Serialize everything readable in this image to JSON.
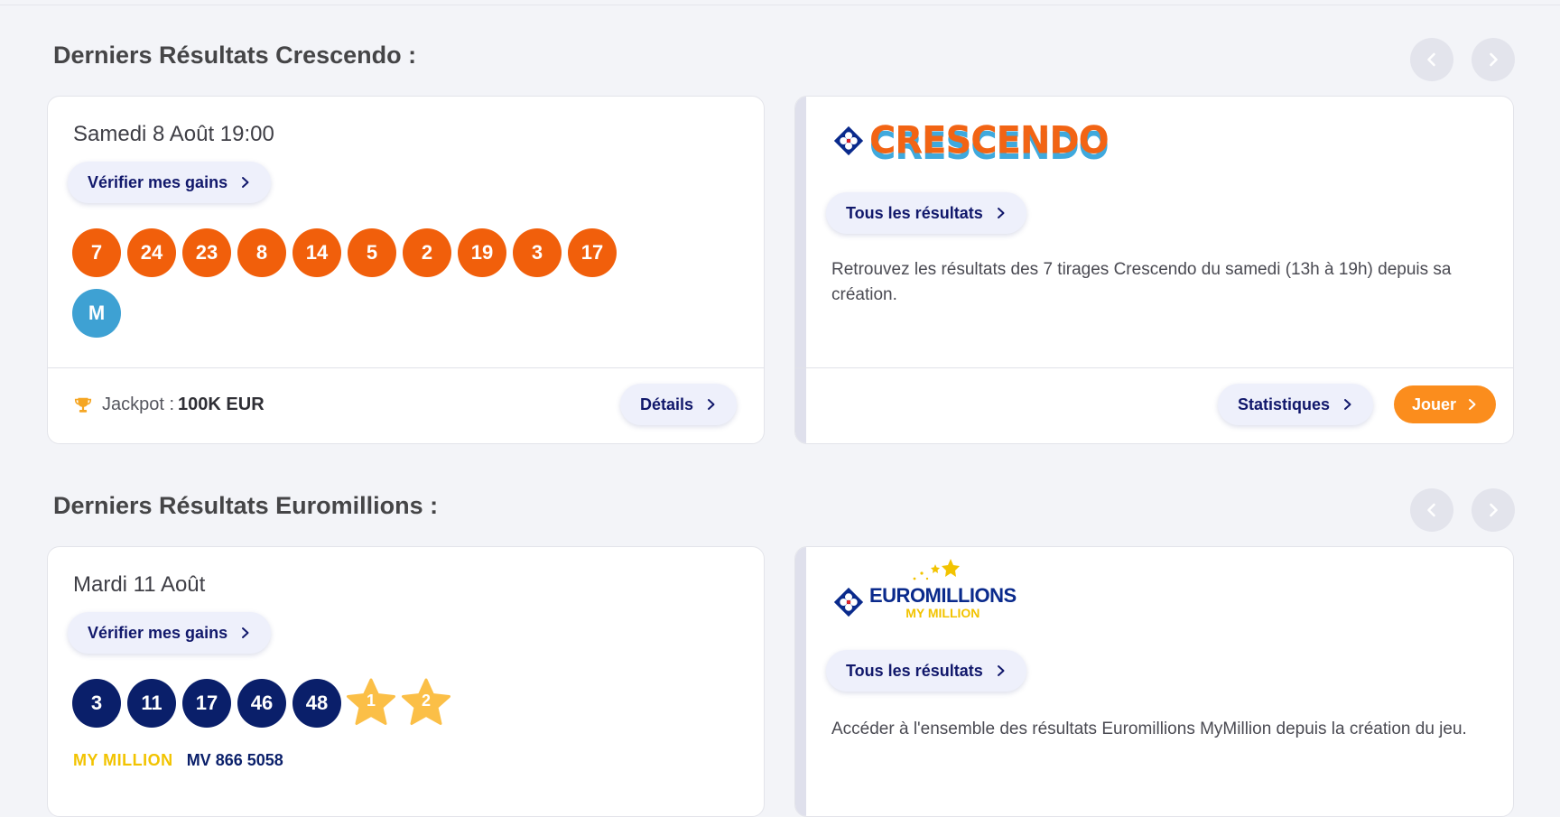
{
  "sections": [
    {
      "title": "Derniers Résultats Crescendo :",
      "draw": {
        "date": "Samedi 8 Août 19:00",
        "verify_label": "Vérifier mes gains",
        "numbers": [
          "7",
          "24",
          "23",
          "8",
          "14",
          "5",
          "2",
          "19",
          "3",
          "17"
        ],
        "special": "M",
        "jackpot_label": "Jackpot :",
        "jackpot_value": "100K EUR",
        "details_label": "Détails"
      },
      "game": {
        "logo_text": "CRESCENDO",
        "all_results_label": "Tous les résultats",
        "description": "Retrouvez les résultats des 7 tirages Crescendo du samedi (13h à 19h) depuis sa création.",
        "stats_label": "Statistiques",
        "play_label": "Jouer"
      }
    },
    {
      "title": "Derniers Résultats Euromillions :",
      "draw": {
        "date": "Mardi 11 Août",
        "verify_label": "Vérifier mes gains",
        "numbers": [
          "3",
          "11",
          "17",
          "46",
          "48"
        ],
        "stars": [
          "1",
          "2"
        ],
        "mymillion_logo": "MY MILLION",
        "mymillion_code": "MV 866 5058"
      },
      "game": {
        "logo_line1": "EUROMILLIONS",
        "logo_line2": "MY MILLION",
        "all_results_label": "Tous les résultats",
        "description": "Accéder à l'ensemble des résultats Euromillions MyMillion depuis la création du jeu."
      }
    }
  ],
  "icons": {
    "prev": "chevron-left-icon",
    "next": "chevron-right-icon",
    "trophy": "trophy-icon",
    "fdj": "fdj-clover-icon"
  },
  "colors": {
    "crescendo_ball": "#f15f0b",
    "special_ball": "#3ea1d3",
    "euro_ball": "#0a1f6a",
    "star": "#fbbf47",
    "play_button": "#fb8d1d",
    "link_text": "#11186b"
  }
}
